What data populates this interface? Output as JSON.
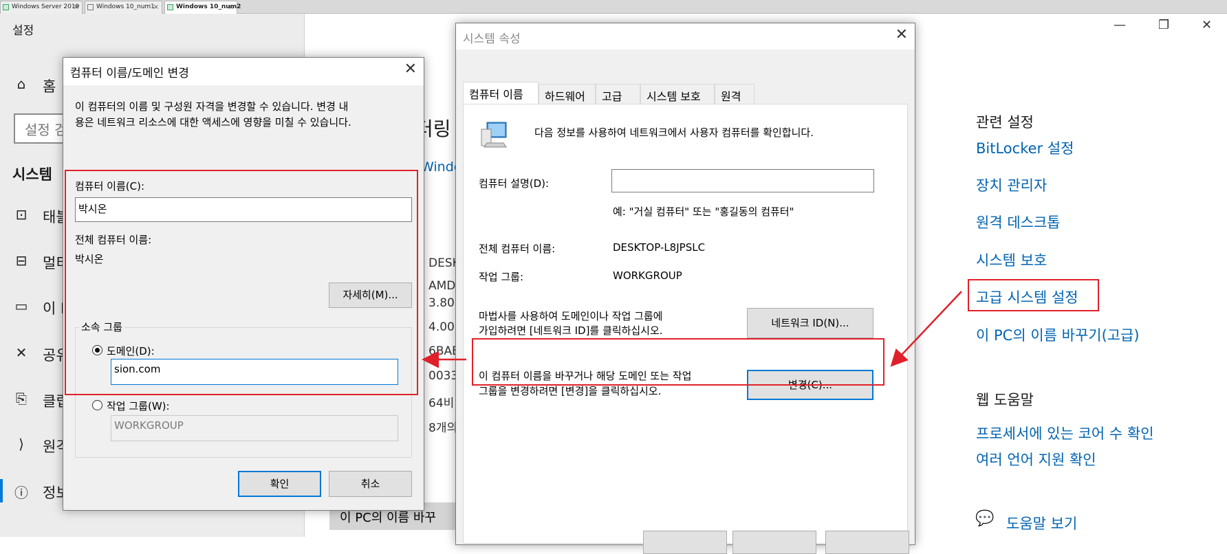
{
  "vm_tabs": [
    {
      "label": "Windows Server 2019",
      "active": false
    },
    {
      "label": "Windows 10_num1",
      "active": false
    },
    {
      "label": "Windows 10_num2",
      "active": true
    }
  ],
  "settings": {
    "app_title": "설정",
    "nav": {
      "home": "홈",
      "search_placeholder": "설정 검",
      "section": "시스템",
      "items": [
        "태블",
        "멀티",
        "이 P",
        "공유",
        "클립",
        "원격",
        "정보"
      ]
    },
    "main": {
      "heading_fragment": "터링",
      "windows_fragment": "Windo",
      "spec_values": [
        "DESK",
        "AMD",
        "3.80",
        "4.00",
        "6BAE",
        "0033",
        "64비",
        "8개의"
      ],
      "rename_button": "이 PC의 이름 바꾸"
    },
    "related": {
      "heading": "관련 설정",
      "links": [
        "BitLocker 설정",
        "장치 관리자",
        "원격 데스크톱",
        "시스템 보호",
        "고급 시스템 설정",
        "이 PC의 이름 바꾸기(고급)"
      ]
    },
    "web_help": {
      "heading": "웹 도움말",
      "links": [
        "프로세서에 있는 코어 수 확인",
        "여러 언어 지원 확인"
      ]
    },
    "help_link": "도움말 보기"
  },
  "sysprops": {
    "title": "시스템 속성",
    "tabs": [
      "컴퓨터 이름",
      "하드웨어",
      "고급",
      "시스템 보호",
      "원격"
    ],
    "intro": "다음 정보를 사용하여 네트워크에서 사용자 컴퓨터를 확인합니다.",
    "desc_label": "컴퓨터 설명(D):",
    "desc_value": "",
    "desc_example": "예: \"거실 컴퓨터\" 또는 \"홍길동의 컴퓨터\"",
    "fullname_label": "전체 컴퓨터 이름:",
    "fullname_value": "DESKTOP-L8JPSLC",
    "workgroup_label": "작업 그룹:",
    "workgroup_value": "WORKGROUP",
    "wizard_text_1": "마법사를 사용하여 도메인이나 작업 그룹에",
    "wizard_text_2": "가입하려면 [네트워크 ID]를 클릭하십시오.",
    "network_id_button": "네트워크 ID(N)...",
    "change_text_1": "이 컴퓨터 이름을 바꾸거나 해당 도메인 또는 작업",
    "change_text_2": "그룹을 변경하려면 [변경]을 클릭하십시오.",
    "change_button": "변경(C)..."
  },
  "rename_dialog": {
    "title": "컴퓨터 이름/도메인 변경",
    "intro_1": "이 컴퓨터의 이름 및 구성원 자격을 변경할 수 있습니다. 변경 내",
    "intro_2": "용은 네트워크 리소스에 대한 액세스에 영향을 미칠 수 있습니다.",
    "name_label": "컴퓨터 이름(C):",
    "name_value": "박시온",
    "fullname_label": "전체 컴퓨터 이름:",
    "fullname_value": "박시온",
    "more_button": "자세히(M)...",
    "member_of": "소속 그룹",
    "domain_label": "도메인(D):",
    "domain_value": "sion.com",
    "workgroup_label": "작업 그룹(W):",
    "workgroup_value": "WORKGROUP",
    "ok": "확인",
    "cancel": "취소",
    "selected": "domain"
  },
  "colors": {
    "annotation_red": "#e0202a",
    "link_blue": "#0063b1",
    "focus_blue": "#0078d7"
  }
}
